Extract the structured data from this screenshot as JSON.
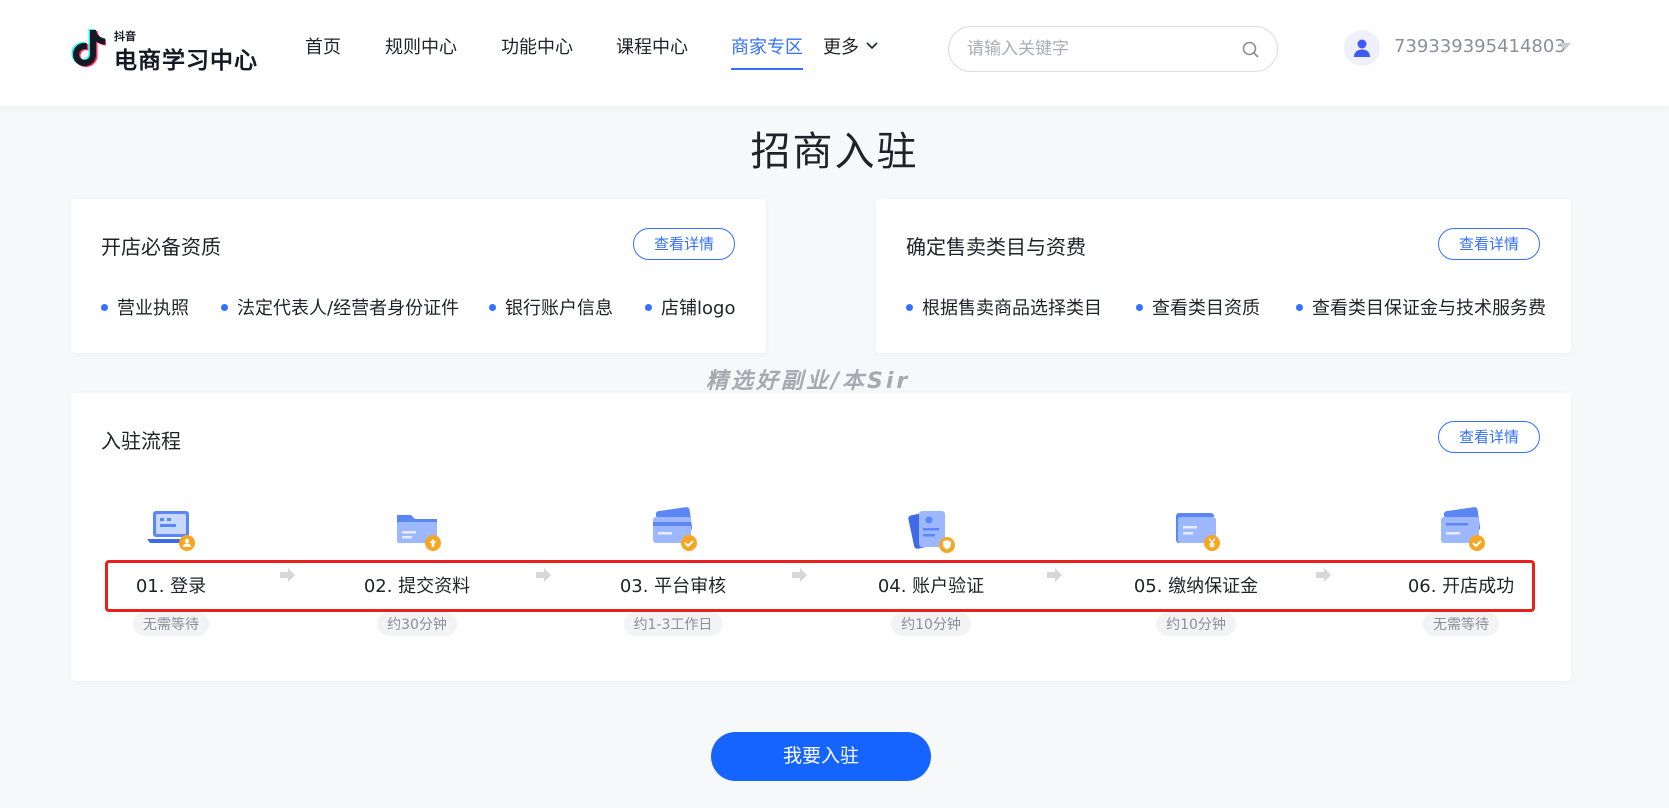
{
  "header": {
    "logo_small": "抖音",
    "logo_big": "电商学习中心",
    "nav": [
      {
        "label": "首页",
        "active": false
      },
      {
        "label": "规则中心",
        "active": false
      },
      {
        "label": "功能中心",
        "active": false
      },
      {
        "label": "课程中心",
        "active": false
      },
      {
        "label": "商家专区",
        "active": true
      },
      {
        "label": "更多",
        "active": false
      }
    ],
    "search_placeholder": "请输入关键字",
    "user_id": "739339395414803"
  },
  "page_title": "招商入驻",
  "cards": {
    "qualification": {
      "title": "开店必备资质",
      "detail_label": "查看详情",
      "items": [
        "营业执照",
        "法定代表人/经营者身份证件",
        "银行账户信息",
        "店铺logo"
      ]
    },
    "category": {
      "title": "确定售卖类目与资费",
      "detail_label": "查看详情",
      "items": [
        "根据售卖商品选择类目",
        "查看类目资质",
        "查看类目保证金与技术服务费"
      ]
    },
    "process": {
      "title": "入驻流程",
      "detail_label": "查看详情",
      "steps": [
        {
          "label": "01. 登录",
          "time": "无需等待",
          "icon": "laptop-user-icon"
        },
        {
          "label": "02. 提交资料",
          "time": "约30分钟",
          "icon": "folder-upload-icon"
        },
        {
          "label": "03. 平台审核",
          "time": "约1-3工作日",
          "icon": "card-check-icon"
        },
        {
          "label": "04. 账户验证",
          "time": "约10分钟",
          "icon": "id-card-shield-icon"
        },
        {
          "label": "05. 缴纳保证金",
          "time": "约10分钟",
          "icon": "card-yen-icon"
        },
        {
          "label": "06. 开店成功",
          "time": "无需等待",
          "icon": "card-success-icon"
        }
      ]
    }
  },
  "watermark": "精选好副业/本Sir",
  "apply_button": "我要入驻",
  "colors": {
    "accent": "#3370ff",
    "button": "#1664ff",
    "highlight": "#e8221b",
    "badge": "#f5a623"
  }
}
